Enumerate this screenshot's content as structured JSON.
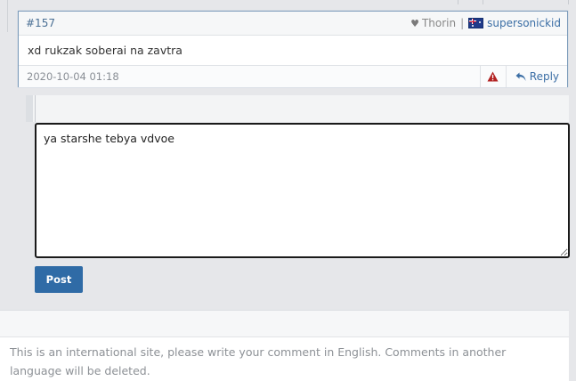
{
  "comment": {
    "number": "#157",
    "likes_user": "Thorin",
    "separator": "|",
    "author": "supersonickid",
    "body": "xd rukzak soberai na zavtra",
    "date": "2020-10-04 01:18",
    "reply_label": "Reply",
    "icons": {
      "like": "heart-icon",
      "flag": "australia-flag-icon",
      "report": "warning-icon",
      "reply": "reply-arrow-icon"
    },
    "colors": {
      "link": "#3b6ea5",
      "report": "#b22222",
      "border": "#7d9cbb"
    }
  },
  "reply_form": {
    "text_value": "ya starshe tebya vdvoe",
    "post_label": "Post",
    "post_color": "#2f6ba6"
  },
  "notice": {
    "text": "This is an international site, please write your comment in English. Comments in another language will be deleted."
  }
}
